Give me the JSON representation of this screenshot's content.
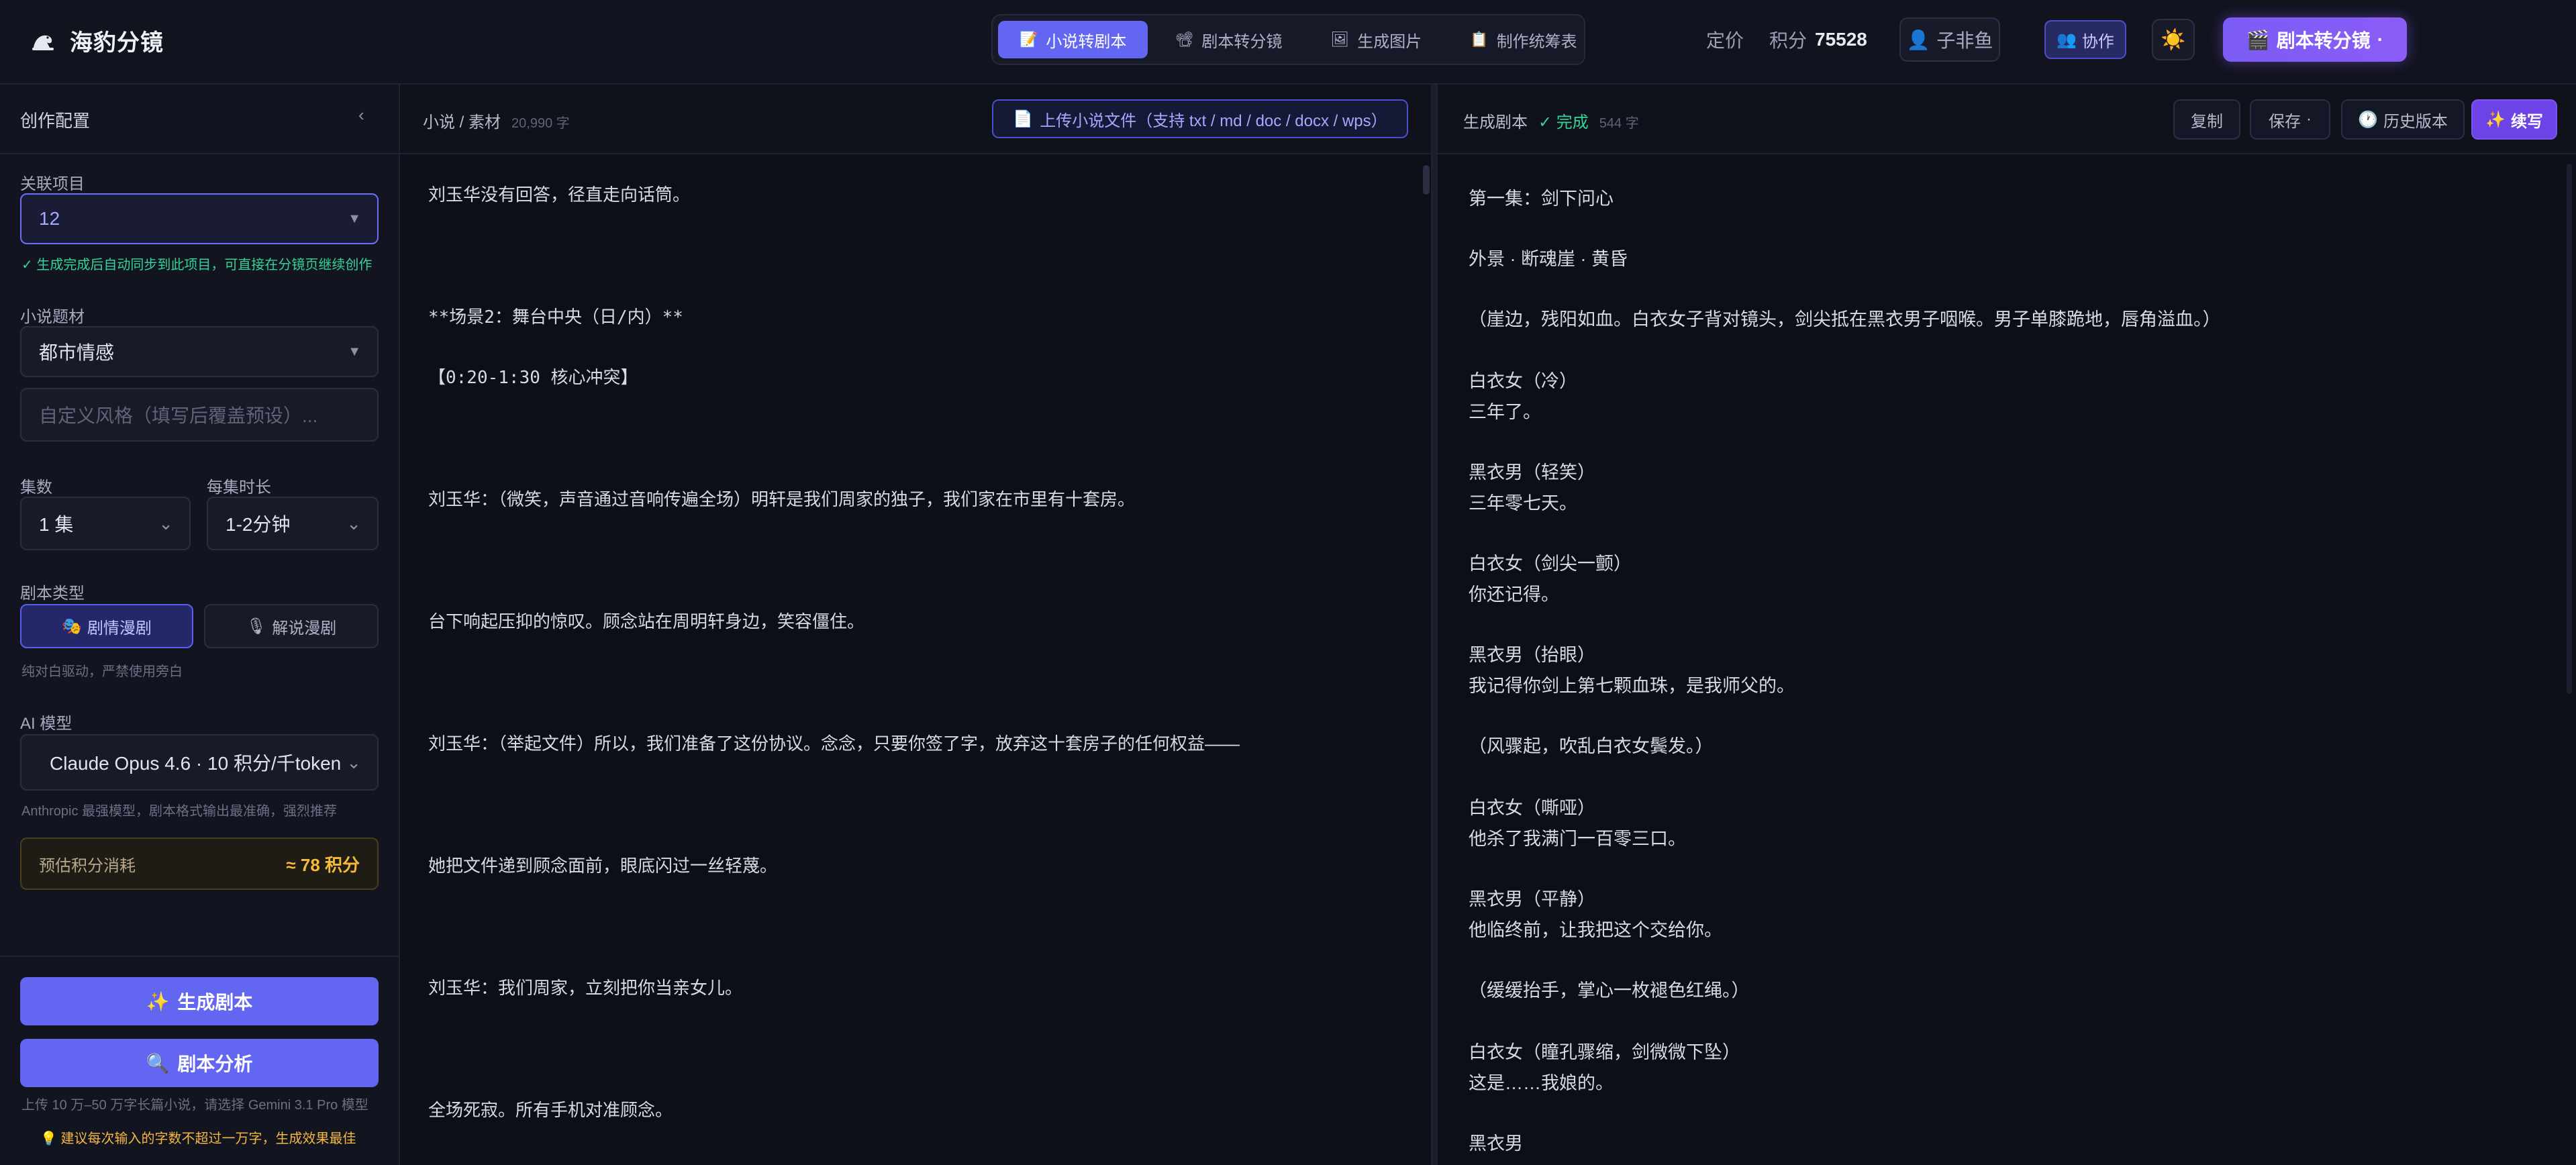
{
  "app": {
    "name": "海豹分镜",
    "logo_icon": "seal-icon"
  },
  "nav": {
    "tabs": [
      {
        "label": "小说转剧本",
        "icon": "📝",
        "active": true
      },
      {
        "label": "剧本转分镜",
        "icon": "📽",
        "active": false
      },
      {
        "label": "生成图片",
        "icon": "🖼",
        "active": false
      },
      {
        "label": "制作统筹表",
        "icon": "📋",
        "active": false
      }
    ]
  },
  "header": {
    "pricing": "定价",
    "points_label": "积分",
    "points_value": "75528",
    "user_icon": "👤",
    "user_name": "子非鱼",
    "collab_icon": "👥",
    "collab_label": "协作",
    "theme_icon": "☀️",
    "convert_icon": "🎬",
    "convert_label": "剧本转分镜",
    "convert_caret": "·"
  },
  "sidebar": {
    "title": "创作配置",
    "collapse_icon": "‹",
    "project_label": "关联项目",
    "project_value": "12",
    "project_hint": "✓ 生成完成后自动同步到此项目，可直接在分镜页继续创作",
    "genre_label": "小说题材",
    "genre_value": "都市情感",
    "style_placeholder": "自定义风格（填写后覆盖预设）...",
    "episodes_label": "集数",
    "episodes_value": "1 集",
    "duration_label": "每集时长",
    "duration_value": "1-2分钟",
    "script_type_label": "剧本类型",
    "type_drama_icon": "🎭",
    "type_drama": "剧情漫剧",
    "type_narration_icon": "🎙",
    "type_narration": "解说漫剧",
    "type_hint": "纯对白驱动，严禁使用旁白",
    "model_label": "AI 模型",
    "model_value": "Claude Opus 4.6 · 10 积分/千token",
    "model_hint": "Anthropic 最强模型，剧本格式输出最准确，强烈推荐",
    "estimate_label": "预估积分消耗",
    "estimate_value": "≈ 78 积分",
    "generate_icon": "✨",
    "generate_label": "生成剧本",
    "analyze_icon": "🔍",
    "analyze_label": "剧本分析",
    "upload_note": "上传 10 万–50 万字长篇小说，请选择 Gemini 3.1 Pro 模型",
    "tip": "💡 建议每次输入的字数不超过一万字，生成效果最佳"
  },
  "source": {
    "title": "小说 / 素材",
    "count": "20,990 字",
    "upload_icon": "📄",
    "upload_label": "上传小说文件（支持 txt / md / doc / docx / wps）",
    "lines": [
      "刘玉华没有回答，径直走向话筒。",
      "**场景2：舞台中央（日/内）**",
      "【0:20-1:30 核心冲突】",
      "刘玉华：（微笑，声音通过音响传遍全场）明轩是我们周家的独子，我们家在市里有十套房。",
      "台下响起压抑的惊叹。顾念站在周明轩身边，笑容僵住。",
      "刘玉华：（举起文件）所以，我们准备了这份协议。念念，只要你签了字，放弃这十套房子的任何权益——",
      "她把文件递到顾念面前，眼底闪过一丝轻蔑。",
      "刘玉华：我们周家，立刻把你当亲女儿。",
      "全场死寂。所有手机对准顾念。"
    ]
  },
  "output": {
    "title": "生成剧本",
    "status": "✓ 完成",
    "count": "544 字",
    "copy_label": "复制",
    "save_label": "保存",
    "save_caret": "·",
    "history_icon": "🕐",
    "history_label": "历史版本",
    "continue_icon": "✨",
    "continue_label": "续写",
    "lines": [
      "第一集：剑下问心",
      "外景 · 断魂崖 · 黄昏",
      "（崖边，残阳如血。白衣女子背对镜头，剑尖抵在黑衣男子咽喉。男子单膝跪地，唇角溢血。）",
      "白衣女（冷）",
      "三年了。",
      "黑衣男（轻笑）",
      "三年零七天。",
      "白衣女（剑尖一颤）",
      "你还记得。",
      "黑衣男（抬眼）",
      "我记得你剑上第七颗血珠，是我师父的。",
      "（风骤起，吹乱白衣女鬓发。）",
      "白衣女（嘶哑）",
      "他杀了我满门一百零三口。",
      "黑衣男（平静）",
      "他临终前，让我把这个交给你。",
      "（缓缓抬手，掌心一枚褪色红绳。）",
      "白衣女（瞳孔骤缩，剑微微下坠）",
      "这是……我娘的。",
      "黑衣男"
    ]
  }
}
